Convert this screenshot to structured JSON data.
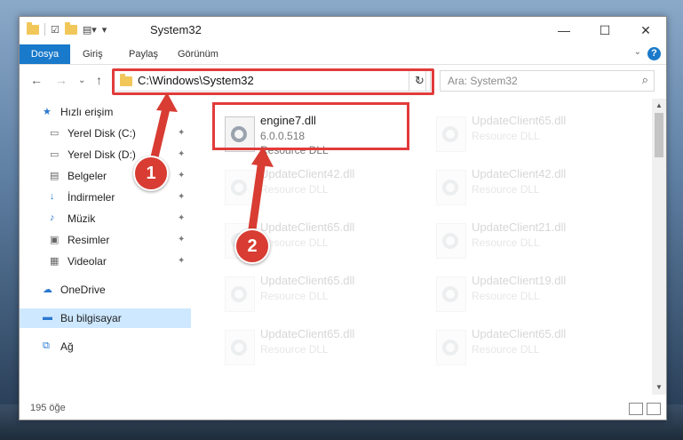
{
  "window": {
    "title": "System32"
  },
  "ribbon": {
    "tabs": [
      "Dosya",
      "Giriş",
      "Paylaş",
      "Görünüm"
    ],
    "help": "?"
  },
  "navigation": {
    "address": "C:\\Windows\\System32",
    "search_placeholder": "Ara: System32"
  },
  "sidebar": {
    "items": [
      {
        "label": "Hızlı erişim",
        "icon": "star-icon",
        "pinned": false
      },
      {
        "label": "Yerel Disk (C:)",
        "icon": "drive-icon",
        "pinned": true
      },
      {
        "label": "Yerel Disk (D:)",
        "icon": "drive-icon",
        "pinned": true
      },
      {
        "label": "Belgeler",
        "icon": "documents-icon",
        "pinned": true
      },
      {
        "label": "İndirmeler",
        "icon": "download-icon",
        "pinned": true
      },
      {
        "label": "Müzik",
        "icon": "music-icon",
        "pinned": true
      },
      {
        "label": "Resimler",
        "icon": "pictures-icon",
        "pinned": true
      },
      {
        "label": "Videolar",
        "icon": "videos-icon",
        "pinned": true
      },
      {
        "label": "OneDrive",
        "icon": "cloud-icon",
        "pinned": false
      },
      {
        "label": "Bu bilgisayar",
        "icon": "computer-icon",
        "pinned": false
      },
      {
        "label": "Ağ",
        "icon": "network-icon",
        "pinned": false
      }
    ]
  },
  "files": [
    {
      "name": "engine7.dll",
      "version": "6.0.0.518",
      "type": "Resource DLL",
      "highlighted": true
    },
    {
      "name": "UpdateClient65.dll",
      "type": "Resource DLL"
    },
    {
      "name": "UpdateClient42.dll",
      "type": "Resource DLL"
    },
    {
      "name": "UpdateClient42.dll",
      "type": "Resource DLL"
    },
    {
      "name": "UpdateClient65.dll",
      "type": "Resource DLL"
    },
    {
      "name": "UpdateClient21.dll",
      "type": "Resource DLL"
    },
    {
      "name": "UpdateClient65.dll",
      "type": "Resource DLL"
    },
    {
      "name": "UpdateClient19.dll",
      "type": "Resource DLL"
    },
    {
      "name": "UpdateClient65.dll",
      "type": "Resource DLL"
    },
    {
      "name": "UpdateClient65.dll",
      "type": "Resource DLL"
    }
  ],
  "status": {
    "count": "195 öğe"
  },
  "callouts": [
    "1",
    "2"
  ],
  "colors": {
    "accent": "#1979ca",
    "callout": "#d83c32",
    "highlight": "#e23b3b"
  }
}
